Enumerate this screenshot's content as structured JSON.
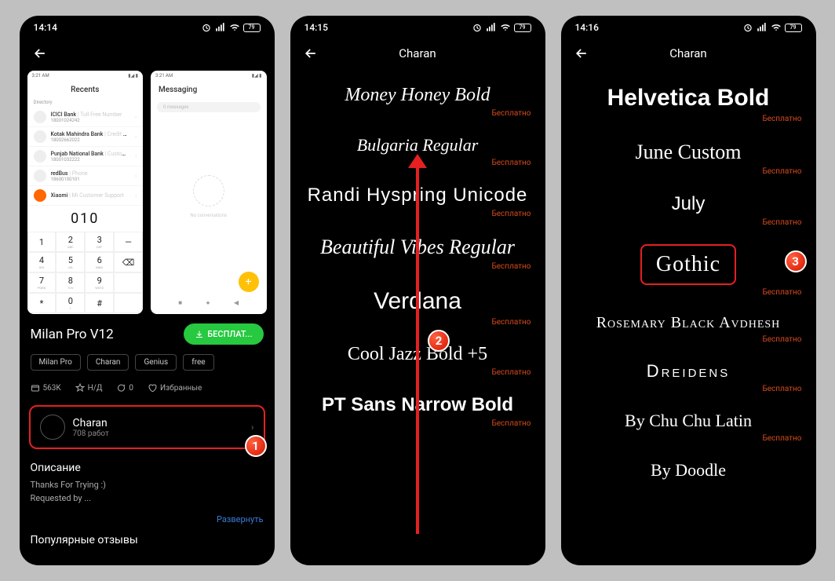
{
  "screen1": {
    "time": "14:14",
    "battery": "79",
    "preview_left": {
      "time": "3:21 AM",
      "heading": "Recents",
      "directory": "Directory",
      "contacts": [
        {
          "name": "ICICI Bank",
          "meta": "Toll Free Number",
          "sub": "18001024242"
        },
        {
          "name": "Kotak Mahindra Bank",
          "meta": "Credit Car...",
          "sub": "18002662022"
        },
        {
          "name": "Punjab National Bank",
          "meta": "Customer...",
          "sub": "18001032222"
        },
        {
          "name": "redBus",
          "meta": "Phone",
          "sub": "18600100101"
        },
        {
          "name": "Xiaomi",
          "meta": "Mi Customer Support",
          "sub": ""
        }
      ],
      "dialed": "010",
      "keys": [
        [
          "1",
          ""
        ],
        [
          "2",
          "ABC"
        ],
        [
          "3",
          "DEF"
        ],
        [
          "—",
          ""
        ],
        [
          "4",
          "GHI"
        ],
        [
          "5",
          "JKL"
        ],
        [
          "6",
          "MNO"
        ],
        [
          "⌫",
          ""
        ],
        [
          "7",
          "PQRS"
        ],
        [
          "8",
          "TUV"
        ],
        [
          "9",
          "WXYZ"
        ],
        [
          "",
          ""
        ],
        [
          "*",
          ""
        ],
        [
          "0",
          "+"
        ],
        [
          "#",
          ""
        ],
        [
          "",
          ""
        ]
      ]
    },
    "preview_right": {
      "time": "3:21 AM",
      "heading": "Messaging",
      "search_placeholder": "0 messages",
      "empty": "No conversations"
    },
    "theme_name": "Milan Pro V12",
    "download_label": "БЕСПЛАТ...",
    "tags": [
      "Milan Pro",
      "Charan",
      "Genius",
      "free"
    ],
    "stats": {
      "downloads": "563K",
      "rating": "Н/Д",
      "comments": "0",
      "favorites": "Избранные"
    },
    "author": {
      "name": "Charan",
      "works": "708 работ"
    },
    "description_heading": "Описание",
    "description_text": "Thanks For Trying :)\nRequested by ...",
    "expand": "Развернуть",
    "reviews_heading": "Популярные отзывы"
  },
  "screen2": {
    "time": "14:15",
    "battery": "79",
    "title": "Charan",
    "free_label": "Бесплатно",
    "fonts": [
      {
        "name": "Money Honey Bold",
        "cls": "f-script"
      },
      {
        "name": "Bulgaria Regular",
        "cls": "f-serif-cond"
      },
      {
        "name": "Randi Hyspring Unicode",
        "cls": "f-sans-heavy"
      },
      {
        "name": "Beautiful Vibes Regular",
        "cls": "f-italic-script"
      },
      {
        "name": "Verdana",
        "cls": "f-verdana"
      },
      {
        "name": "Cool Jazz Bold +5",
        "cls": "f-hand"
      },
      {
        "name": "PT Sans Narrow Bold",
        "cls": "f-narrow"
      }
    ]
  },
  "screen3": {
    "time": "14:16",
    "battery": "79",
    "title": "Charan",
    "free_label": "Бесплатно",
    "fonts": [
      {
        "name": "Helvetica Bold",
        "cls": "f-helv"
      },
      {
        "name": "June Custom",
        "cls": "f-hand2"
      },
      {
        "name": "July",
        "cls": "f-thin"
      },
      {
        "name": "Gothic",
        "cls": "f-gothic",
        "highlight": true
      },
      {
        "name": "Rosemary Black Avdhesh",
        "cls": "f-blackletter"
      },
      {
        "name": "Dreidens",
        "cls": "f-spaced"
      },
      {
        "name": "By Chu Chu Latin",
        "cls": "f-chu"
      },
      {
        "name": "By Doodle",
        "cls": "f-chu"
      }
    ]
  },
  "badges": {
    "b1": "1",
    "b2": "2",
    "b3": "3"
  }
}
